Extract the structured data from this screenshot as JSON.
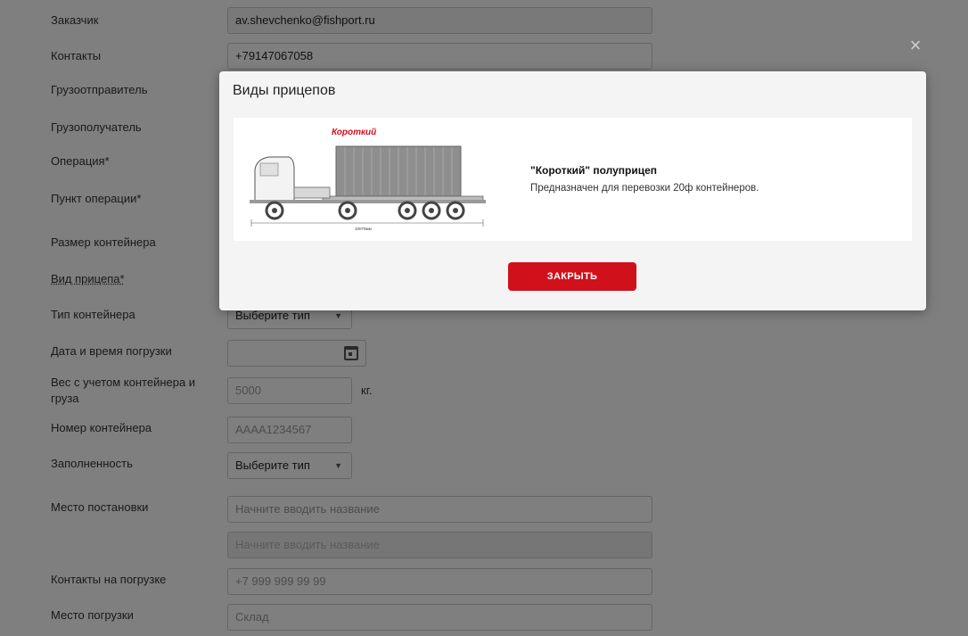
{
  "form": {
    "customer": {
      "label": "Заказчик",
      "value": "av.shevchenko@fishport.ru"
    },
    "contacts": {
      "label": "Контакты",
      "value": "+79147067058"
    },
    "shipper": {
      "label": "Грузоотправитель"
    },
    "consignee": {
      "label": "Грузополучатель"
    },
    "operation": {
      "label": "Операция*"
    },
    "operation_point": {
      "label": "Пункт операции*"
    },
    "container_size": {
      "label": "Размер контейнера"
    },
    "trailer_type": {
      "label": "Вид прицепа*"
    },
    "container_type": {
      "label": "Тип контейнера",
      "value": "Выберите тип"
    },
    "loading_datetime": {
      "label": "Дата и время погрузки"
    },
    "weight": {
      "label_line1": "Вес с учетом контейнера и",
      "label_line2": "груза",
      "placeholder": "5000",
      "unit": "кг."
    },
    "container_number": {
      "label": "Номер контейнера",
      "placeholder": "AAAA1234567"
    },
    "fullness": {
      "label": "Заполненность",
      "value": "Выберите тип"
    },
    "placement": {
      "label": "Место постановки",
      "placeholder": "Начните вводить название",
      "placeholder2": "Начните вводить название"
    },
    "loading_contacts": {
      "label": "Контакты на погрузке",
      "placeholder": "+7 999 999 99 99"
    },
    "loading_place": {
      "label": "Место погрузки",
      "placeholder": "Склад"
    }
  },
  "modal": {
    "title": "Виды прицепов",
    "trailer": {
      "image_caption": "Короткий",
      "dimension_label": "10070мм",
      "name": "\"Короткий\" полуприцеп",
      "description": "Предназначен для перевозки 20ф контейнеров."
    },
    "close_button": "ЗАКРЫТЬ",
    "close_icon": "close-icon"
  },
  "colors": {
    "accent": "#d0101a",
    "overlay": "rgba(0,0,0,0.5)"
  }
}
